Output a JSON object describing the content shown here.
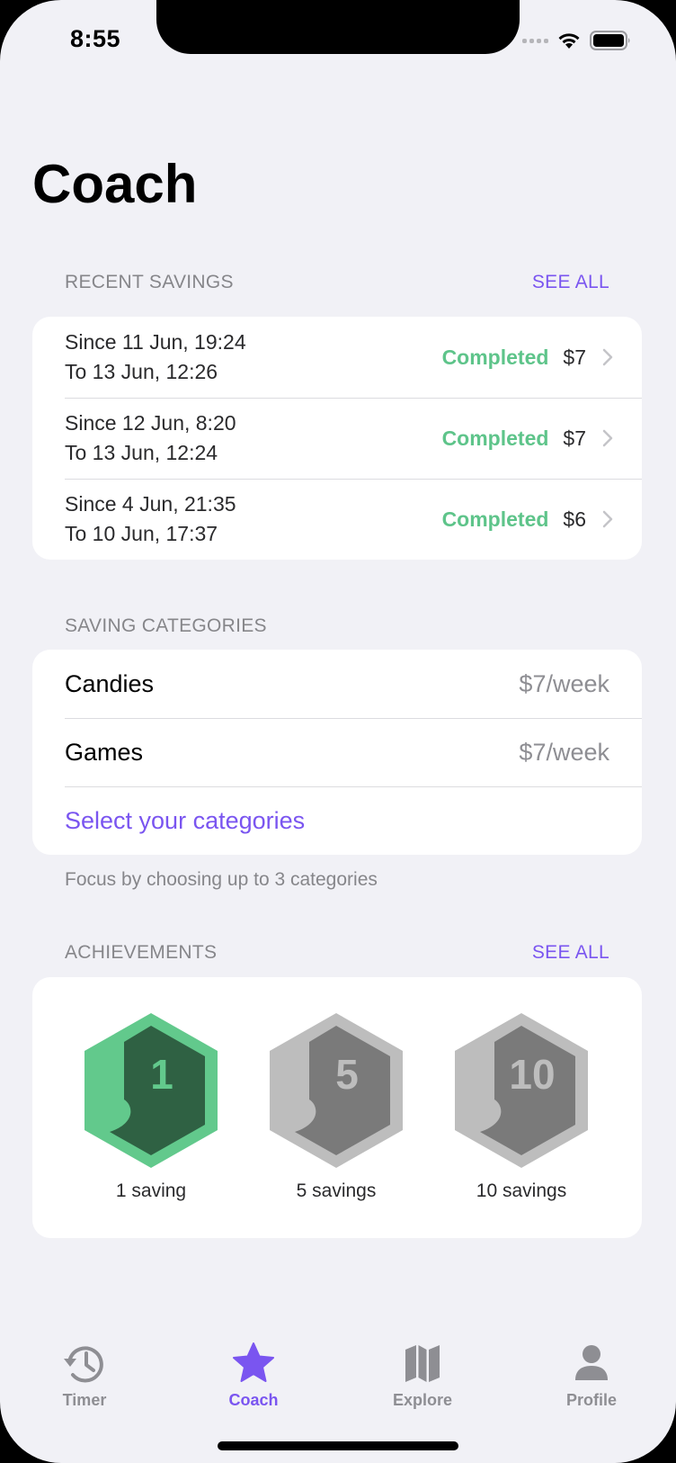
{
  "status_bar": {
    "time": "8:55"
  },
  "page_title": "Coach",
  "recent_savings": {
    "header": "RECENT SAVINGS",
    "see_all": "SEE ALL",
    "items": [
      {
        "since": "Since 11 Jun, 19:24",
        "to": "To 13 Jun, 12:26",
        "status": "Completed",
        "amount": "$7"
      },
      {
        "since": "Since 12 Jun, 8:20",
        "to": "To 13 Jun, 12:24",
        "status": "Completed",
        "amount": "$7"
      },
      {
        "since": "Since 4 Jun, 21:35",
        "to": "To 10 Jun, 17:37",
        "status": "Completed",
        "amount": "$6"
      }
    ]
  },
  "saving_categories": {
    "header": "SAVING CATEGORIES",
    "items": [
      {
        "name": "Candies",
        "value": "$7/week"
      },
      {
        "name": "Games",
        "value": "$7/week"
      }
    ],
    "select_link": "Select your categories",
    "footnote": "Focus by choosing up to 3 categories"
  },
  "achievements": {
    "header": "ACHIEVEMENTS",
    "see_all": "SEE ALL",
    "badges": [
      {
        "number": "1",
        "label": "1 saving",
        "state": "earned"
      },
      {
        "number": "5",
        "label": "5 savings",
        "state": "locked"
      },
      {
        "number": "10",
        "label": "10 savings",
        "state": "locked"
      }
    ]
  },
  "tabbar": {
    "tabs": [
      {
        "label": "Timer",
        "icon": "history-clock-icon"
      },
      {
        "label": "Coach",
        "icon": "star-icon",
        "active": true
      },
      {
        "label": "Explore",
        "icon": "map-icon"
      },
      {
        "label": "Profile",
        "icon": "person-icon"
      }
    ]
  },
  "colors": {
    "accent": "#7a55f0",
    "success": "#5ec48a",
    "badge_earned_outer": "#62c98c",
    "badge_earned_inner": "#2f6143",
    "badge_locked_outer": "#bdbdbd",
    "badge_locked_inner": "#7a7a7a",
    "background": "#f1f1f6"
  }
}
